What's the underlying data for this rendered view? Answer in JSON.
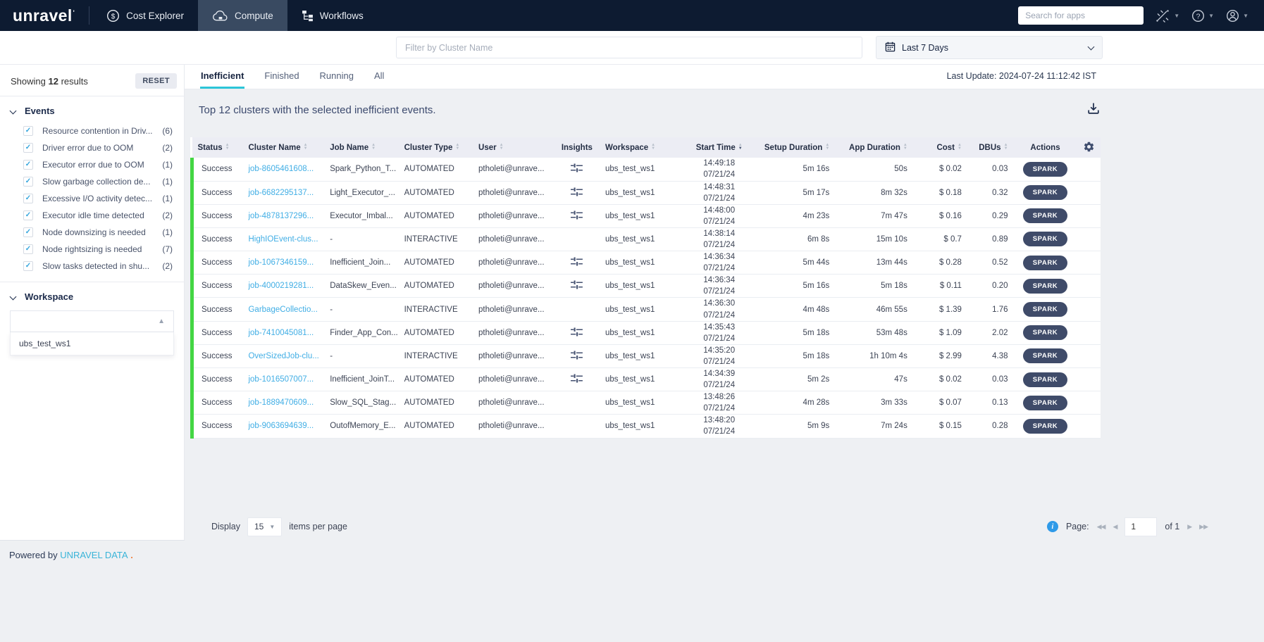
{
  "topnav": {
    "logo": "unravel",
    "items": [
      {
        "label": "Cost Explorer",
        "icon": "dollar-icon",
        "active": false
      },
      {
        "label": "Compute",
        "icon": "cloud-icon",
        "active": true
      },
      {
        "label": "Workflows",
        "icon": "workflow-icon",
        "active": false
      }
    ],
    "search_placeholder": "Search for apps",
    "right_icons": [
      "integrations-icon",
      "help-icon",
      "user-icon"
    ]
  },
  "filter_bar": {
    "cluster_filter_placeholder": "Filter by Cluster Name",
    "date_icon": "calendar-icon",
    "date_range": "Last 7 Days"
  },
  "sidebar": {
    "showing": {
      "prefix": "Showing",
      "count": "12",
      "suffix": "results"
    },
    "reset_label": "RESET",
    "events": {
      "title": "Events",
      "items": [
        {
          "label": "Resource contention in Driv...",
          "count": "(6)",
          "checked": true
        },
        {
          "label": "Driver error due to OOM",
          "count": "(2)",
          "checked": true
        },
        {
          "label": "Executor error due to OOM",
          "count": "(1)",
          "checked": true
        },
        {
          "label": "Slow garbage collection de...",
          "count": "(1)",
          "checked": true
        },
        {
          "label": "Excessive I/O activity detec...",
          "count": "(1)",
          "checked": true
        },
        {
          "label": "Executor idle time detected",
          "count": "(2)",
          "checked": true
        },
        {
          "label": "Node downsizing is needed",
          "count": "(1)",
          "checked": true
        },
        {
          "label": "Node rightsizing is needed",
          "count": "(7)",
          "checked": true
        },
        {
          "label": "Slow tasks detected in shu...",
          "count": "(2)",
          "checked": true
        }
      ]
    },
    "workspace": {
      "title": "Workspace",
      "selected": "",
      "options": [
        "ubs_test_ws1"
      ]
    }
  },
  "main": {
    "tabs": [
      "Inefficient",
      "Finished",
      "Running",
      "All"
    ],
    "active_tab": "Inefficient",
    "last_update": "Last Update: 2024-07-24 11:12:42 IST",
    "heading": "Top 12 clusters with the selected inefficient events.",
    "download_icon": "download-icon",
    "table": {
      "settings_icon": "gear-icon",
      "columns": [
        {
          "label": "Status",
          "sortable": true,
          "align": "al"
        },
        {
          "label": "Cluster Name",
          "sortable": true,
          "align": "al"
        },
        {
          "label": "Job Name",
          "sortable": true,
          "align": "al"
        },
        {
          "label": "Cluster Type",
          "sortable": true,
          "align": "al"
        },
        {
          "label": "User",
          "sortable": true,
          "align": "al"
        },
        {
          "label": "Insights",
          "sortable": false,
          "align": "ac"
        },
        {
          "label": "Workspace",
          "sortable": true,
          "align": "al"
        },
        {
          "label": "Start Time",
          "sortable": true,
          "align": "ac",
          "sorted": "desc"
        },
        {
          "label": "Setup Duration",
          "sortable": true,
          "align": "ar"
        },
        {
          "label": "App Duration",
          "sortable": true,
          "align": "ar"
        },
        {
          "label": "Cost",
          "sortable": true,
          "align": "ar"
        },
        {
          "label": "DBUs",
          "sortable": true,
          "align": "ar"
        },
        {
          "label": "Actions",
          "sortable": false,
          "align": "ac"
        }
      ],
      "rows": [
        {
          "status": "Success",
          "cluster_name": "job-8605461608...",
          "job_name": "Spark_Python_T...",
          "cluster_type": "AUTOMATED",
          "user": "ptholeti@unrave...",
          "insights": true,
          "workspace": "ubs_test_ws1",
          "start_time": "14:49:18",
          "start_date": "07/21/24",
          "setup_duration": "5m 16s",
          "app_duration": "50s",
          "cost": "$ 0.02",
          "dbus": "0.03",
          "action": "SPARK"
        },
        {
          "status": "Success",
          "cluster_name": "job-6682295137...",
          "job_name": "Light_Executor_...",
          "cluster_type": "AUTOMATED",
          "user": "ptholeti@unrave...",
          "insights": true,
          "workspace": "ubs_test_ws1",
          "start_time": "14:48:31",
          "start_date": "07/21/24",
          "setup_duration": "5m 17s",
          "app_duration": "8m 32s",
          "cost": "$ 0.18",
          "dbus": "0.32",
          "action": "SPARK"
        },
        {
          "status": "Success",
          "cluster_name": "job-4878137296...",
          "job_name": "Executor_Imbal...",
          "cluster_type": "AUTOMATED",
          "user": "ptholeti@unrave...",
          "insights": true,
          "workspace": "ubs_test_ws1",
          "start_time": "14:48:00",
          "start_date": "07/21/24",
          "setup_duration": "4m 23s",
          "app_duration": "7m 47s",
          "cost": "$ 0.16",
          "dbus": "0.29",
          "action": "SPARK"
        },
        {
          "status": "Success",
          "cluster_name": "HighIOEvent-clus...",
          "job_name": "-",
          "cluster_type": "INTERACTIVE",
          "user": "ptholeti@unrave...",
          "insights": false,
          "workspace": "ubs_test_ws1",
          "start_time": "14:38:14",
          "start_date": "07/21/24",
          "setup_duration": "6m 8s",
          "app_duration": "15m 10s",
          "cost": "$ 0.7",
          "dbus": "0.89",
          "action": "SPARK"
        },
        {
          "status": "Success",
          "cluster_name": "job-1067346159...",
          "job_name": "Inefficient_Join...",
          "cluster_type": "AUTOMATED",
          "user": "ptholeti@unrave...",
          "insights": true,
          "workspace": "ubs_test_ws1",
          "start_time": "14:36:34",
          "start_date": "07/21/24",
          "setup_duration": "5m 44s",
          "app_duration": "13m 44s",
          "cost": "$ 0.28",
          "dbus": "0.52",
          "action": "SPARK"
        },
        {
          "status": "Success",
          "cluster_name": "job-4000219281...",
          "job_name": "DataSkew_Even...",
          "cluster_type": "AUTOMATED",
          "user": "ptholeti@unrave...",
          "insights": true,
          "workspace": "ubs_test_ws1",
          "start_time": "14:36:34",
          "start_date": "07/21/24",
          "setup_duration": "5m 16s",
          "app_duration": "5m 18s",
          "cost": "$ 0.11",
          "dbus": "0.20",
          "action": "SPARK"
        },
        {
          "status": "Success",
          "cluster_name": "GarbageCollectio...",
          "job_name": "-",
          "cluster_type": "INTERACTIVE",
          "user": "ptholeti@unrave...",
          "insights": false,
          "workspace": "ubs_test_ws1",
          "start_time": "14:36:30",
          "start_date": "07/21/24",
          "setup_duration": "4m 48s",
          "app_duration": "46m 55s",
          "cost": "$ 1.39",
          "dbus": "1.76",
          "action": "SPARK"
        },
        {
          "status": "Success",
          "cluster_name": "job-7410045081...",
          "job_name": "Finder_App_Con...",
          "cluster_type": "AUTOMATED",
          "user": "ptholeti@unrave...",
          "insights": true,
          "workspace": "ubs_test_ws1",
          "start_time": "14:35:43",
          "start_date": "07/21/24",
          "setup_duration": "5m 18s",
          "app_duration": "53m 48s",
          "cost": "$ 1.09",
          "dbus": "2.02",
          "action": "SPARK"
        },
        {
          "status": "Success",
          "cluster_name": "OverSizedJob-clu...",
          "job_name": "-",
          "cluster_type": "INTERACTIVE",
          "user": "ptholeti@unrave...",
          "insights": true,
          "workspace": "ubs_test_ws1",
          "start_time": "14:35:20",
          "start_date": "07/21/24",
          "setup_duration": "5m 18s",
          "app_duration": "1h 10m 4s",
          "cost": "$ 2.99",
          "dbus": "4.38",
          "action": "SPARK"
        },
        {
          "status": "Success",
          "cluster_name": "job-1016507007...",
          "job_name": "Inefficient_JoinT...",
          "cluster_type": "AUTOMATED",
          "user": "ptholeti@unrave...",
          "insights": true,
          "workspace": "ubs_test_ws1",
          "start_time": "14:34:39",
          "start_date": "07/21/24",
          "setup_duration": "5m 2s",
          "app_duration": "47s",
          "cost": "$ 0.02",
          "dbus": "0.03",
          "action": "SPARK"
        },
        {
          "status": "Success",
          "cluster_name": "job-1889470609...",
          "job_name": "Slow_SQL_Stag...",
          "cluster_type": "AUTOMATED",
          "user": "ptholeti@unrave...",
          "insights": false,
          "workspace": "ubs_test_ws1",
          "start_time": "13:48:26",
          "start_date": "07/21/24",
          "setup_duration": "4m 28s",
          "app_duration": "3m 33s",
          "cost": "$ 0.07",
          "dbus": "0.13",
          "action": "SPARK"
        },
        {
          "status": "Success",
          "cluster_name": "job-9063694639...",
          "job_name": "OutofMemory_E...",
          "cluster_type": "AUTOMATED",
          "user": "ptholeti@unrave...",
          "insights": false,
          "workspace": "ubs_test_ws1",
          "start_time": "13:48:20",
          "start_date": "07/21/24",
          "setup_duration": "5m 9s",
          "app_duration": "7m 24s",
          "cost": "$ 0.15",
          "dbus": "0.28",
          "action": "SPARK"
        }
      ]
    },
    "pagination": {
      "display_label": "Display",
      "page_size": "15",
      "per_page_label": "items per page",
      "info_icon": "info-icon",
      "page_label": "Page:",
      "page_value": "1",
      "of_label": "of 1"
    }
  },
  "footer": {
    "powered_prefix": "Powered by ",
    "brand": "UNRAVEL DATA",
    "suffix": " ."
  },
  "colors": {
    "nav_bg": "#0d1b31",
    "nav_active_bg": "#394a61",
    "tab_underline": "#2cc5d8",
    "link_blue": "#41aee5",
    "status_green": "#43d643",
    "spark_pill": "#3f4b69",
    "table_header_bg": "#ecedf4",
    "info_blue": "#2e9ae8",
    "footer_brand": "#39b4d8"
  }
}
